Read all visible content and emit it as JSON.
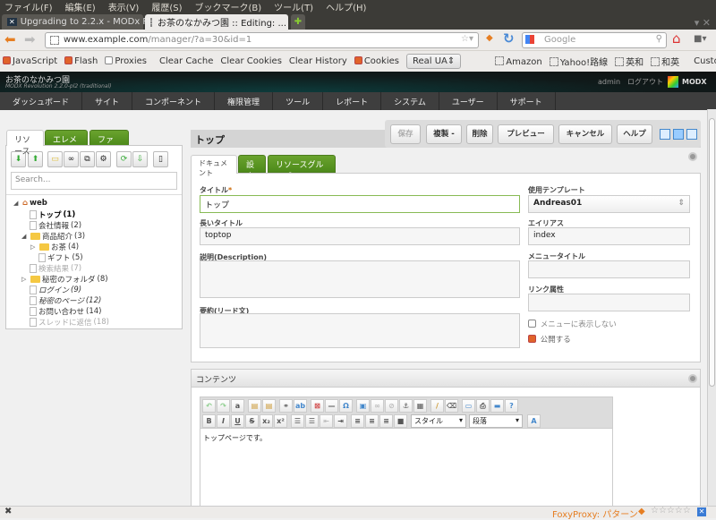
{
  "browser": {
    "menu": [
      "ファイル(F)",
      "編集(E)",
      "表示(V)",
      "履歴(S)",
      "ブックマーク(B)",
      "ツール(T)",
      "ヘルプ(H)"
    ],
    "tabs": [
      {
        "title": "Upgrading to 2.2.x - MODx R..."
      },
      {
        "title": "お茶のなかみつ園 :: Editing: ..."
      }
    ],
    "url_domain": "www.example.com",
    "url_path": "/manager/?a=30&id=1",
    "search_placeholder": "Google",
    "toolbar": {
      "javascript": "JavaScript",
      "flash": "Flash",
      "proxies": "Proxies",
      "clear_cache": "Clear Cache",
      "clear_cookies": "Clear Cookies",
      "clear_history": "Clear History",
      "cookies": "Cookies",
      "ua": "Real UA",
      "bookmarks": [
        "Amazon",
        "Yahoo!路線",
        "英和",
        "和英"
      ],
      "customize": "Customize"
    },
    "status": {
      "foxyproxy": "FoxyProxy: パターン"
    }
  },
  "modx": {
    "site_name": "お茶のなかみつ園",
    "version": "MODX Revolution 2.2.0-pl2 (traditional)",
    "user": "admin",
    "logout": "ログアウト",
    "logo": "MODX",
    "nav": [
      "ダッシュボード",
      "サイト",
      "コンポーネント",
      "権限管理",
      "ツール",
      "レポート",
      "システム",
      "ユーザー",
      "サポート"
    ]
  },
  "left": {
    "tabs": [
      "リソース",
      "エレメント",
      "ファイル"
    ],
    "search_placeholder": "Search...",
    "tree": [
      {
        "label": "web",
        "n": ""
      },
      {
        "label": "トップ",
        "n": "(1)"
      },
      {
        "label": "会社情報",
        "n": "(2)"
      },
      {
        "label": "商品紹介",
        "n": "(3)"
      },
      {
        "label": "お茶",
        "n": "(4)"
      },
      {
        "label": "ギフト",
        "n": "(5)"
      },
      {
        "label": "検索結果",
        "n": "(7)"
      },
      {
        "label": "秘密のフォルダ",
        "n": "(8)"
      },
      {
        "label": "ログイン",
        "n": "(9)"
      },
      {
        "label": "秘密のページ",
        "n": "(12)"
      },
      {
        "label": "お問い合わせ",
        "n": "(14)"
      },
      {
        "label": "スレッドに返信",
        "n": "(18)"
      }
    ]
  },
  "main": {
    "title": "トップ",
    "buttons": [
      "保存",
      "複製 -",
      "削除",
      "プレビュー",
      "キャンセル",
      "ヘルプ"
    ],
    "tabs": [
      "ドキュメント",
      "設定",
      "リソースグループ"
    ],
    "fields": {
      "title_label": "タイトル",
      "title_value": "トップ",
      "longtitle_label": "長いタイトル",
      "longtitle_value": "toptop",
      "description_label": "説明(Description)",
      "introtext_label": "要約(リード文)",
      "template_label": "使用テンプレート",
      "template_value": "Andreas01",
      "alias_label": "エイリアス",
      "alias_value": "index",
      "menutitle_label": "メニュータイトル",
      "link_label": "リンク属性",
      "hidemenu_label": "メニューに表示しない",
      "hidemenu": false,
      "published_label": "公開する",
      "published": true
    },
    "content": {
      "header": "コンテンツ",
      "style_select": "スタイル",
      "format_select": "段落",
      "text": "トップページです。"
    }
  }
}
